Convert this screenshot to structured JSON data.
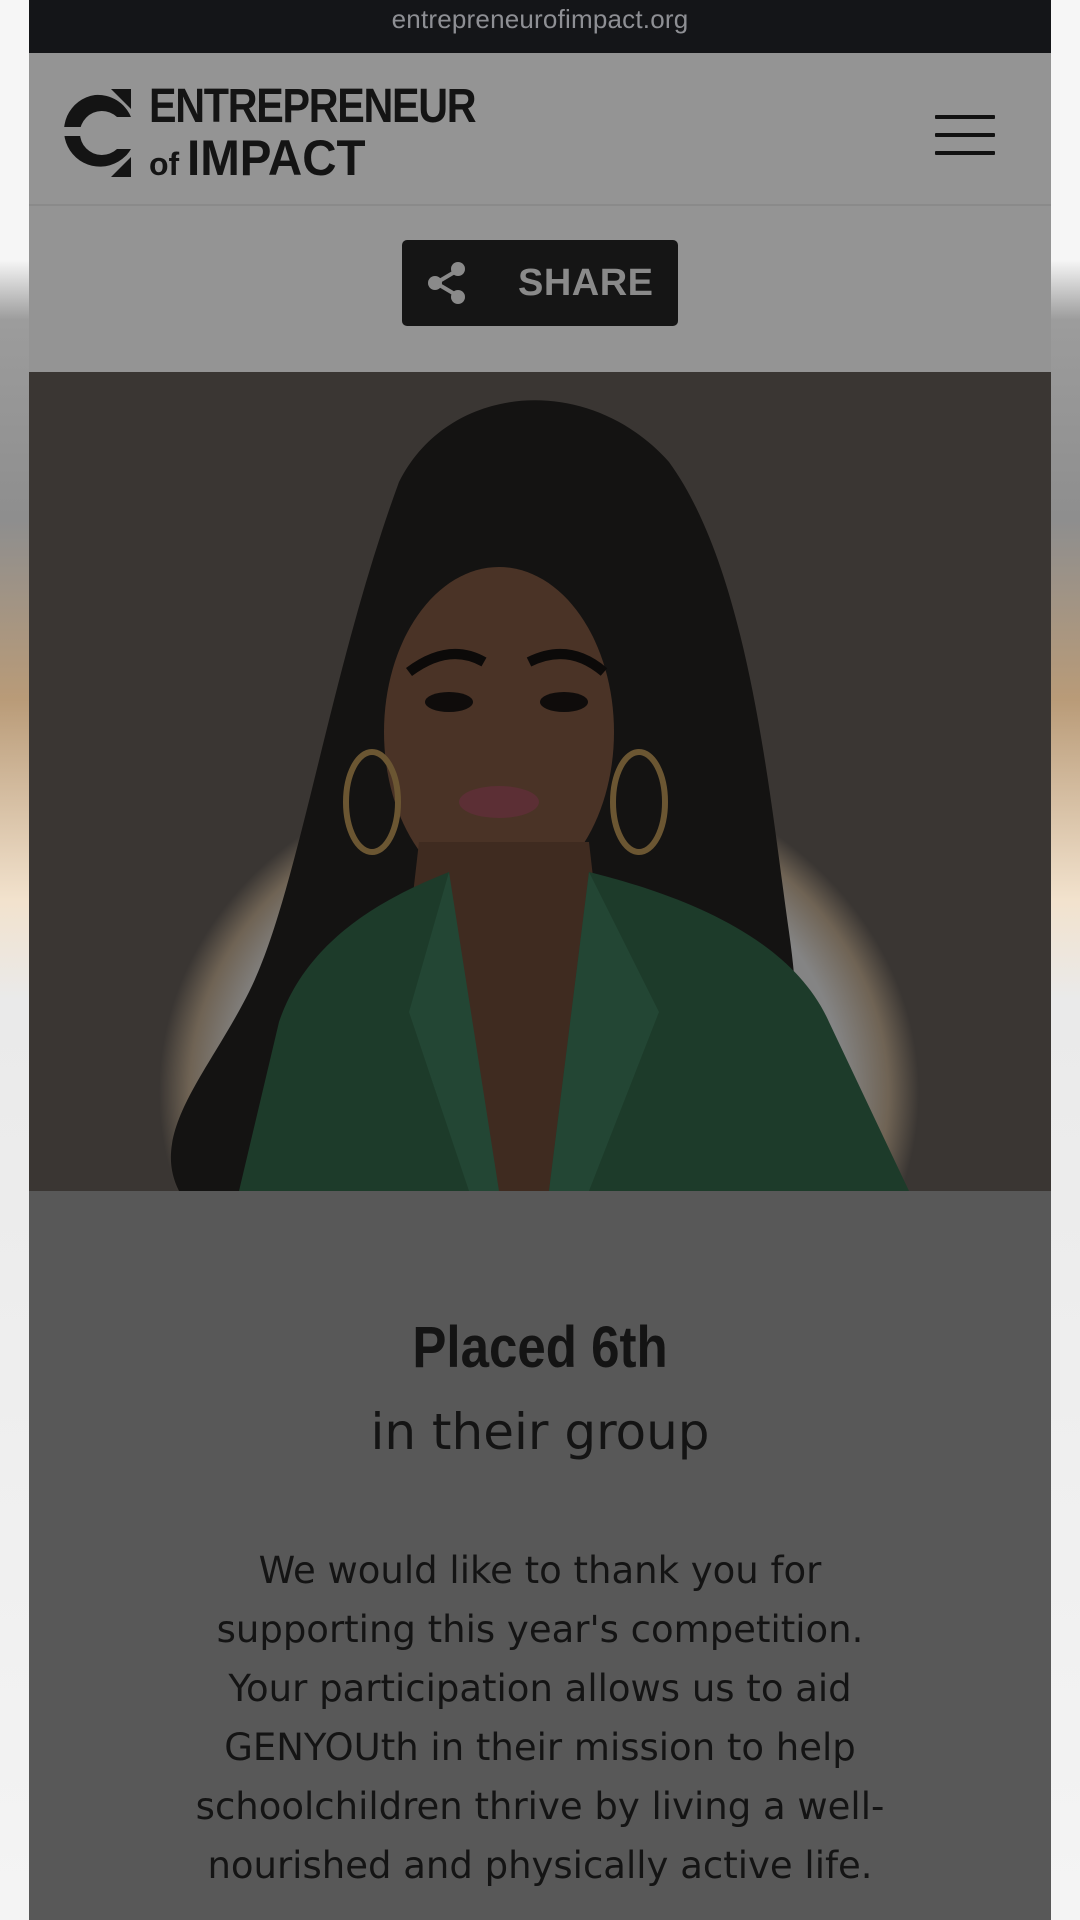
{
  "browser": {
    "url": "entrepreneurofimpact.org"
  },
  "header": {
    "logo_line1": "ENTREPRENEUR",
    "logo_of": "of",
    "logo_impact": "IMPACT",
    "menu_icon": "hamburger-menu-icon"
  },
  "share": {
    "label": "SHARE",
    "icon": "share-icon"
  },
  "result": {
    "title": "Placed 6th",
    "subtitle": "in their group",
    "message": "We would like to thank you for supporting this year's competition. Your participation allows us to aid GENYOUth in their mission to help schoolchildren thrive by living a well-nourished and physically active life."
  },
  "colors": {
    "url_bar": "#141518",
    "header_bg": "#949494",
    "button_bg": "#151515",
    "content_bg": "#585858",
    "jacket_green": "#1d3b2a"
  }
}
